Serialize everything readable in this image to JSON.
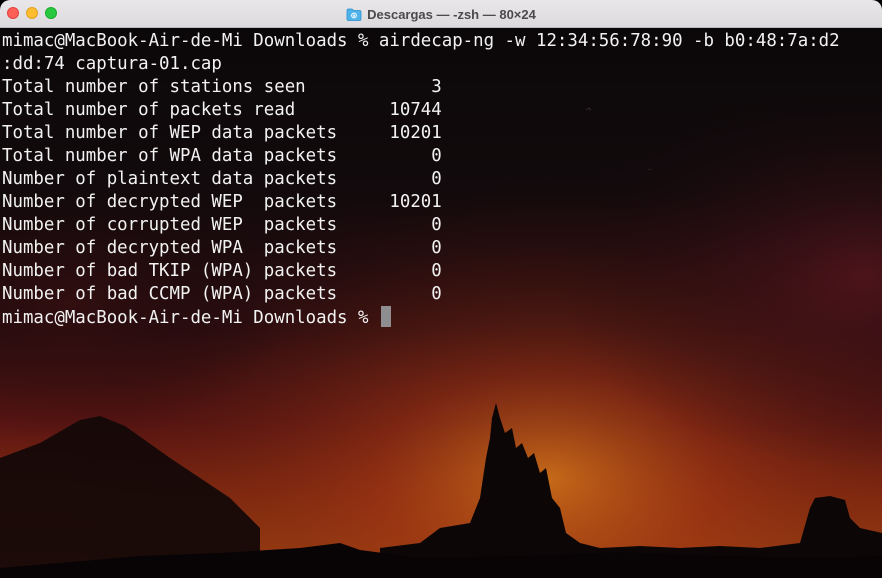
{
  "window": {
    "title": "Descargas — -zsh — 80×24",
    "title_icon": "folder-icon",
    "traffic_lights": {
      "close_color": "#fe5f57",
      "minimize_color": "#febc2e",
      "zoom_color": "#28c840"
    }
  },
  "terminal": {
    "command_line_1": "mimac@MacBook-Air-de-Mi Downloads % airdecap-ng -w 12:34:56:78:90 -b b0:48:7a:d2",
    "command_line_2": ":dd:74 captura-01.cap",
    "output": [
      "Total number of stations seen            3",
      "Total number of packets read         10744",
      "Total number of WEP data packets     10201",
      "Total number of WPA data packets         0",
      "Number of plaintext data packets         0",
      "Number of decrypted WEP  packets     10201",
      "Number of corrupted WEP  packets         0",
      "Number of decrypted WPA  packets         0",
      "Number of bad TKIP (WPA) packets         0",
      "Number of bad CCMP (WPA) packets         0"
    ],
    "prompt": "mimac@MacBook-Air-de-Mi Downloads % "
  }
}
